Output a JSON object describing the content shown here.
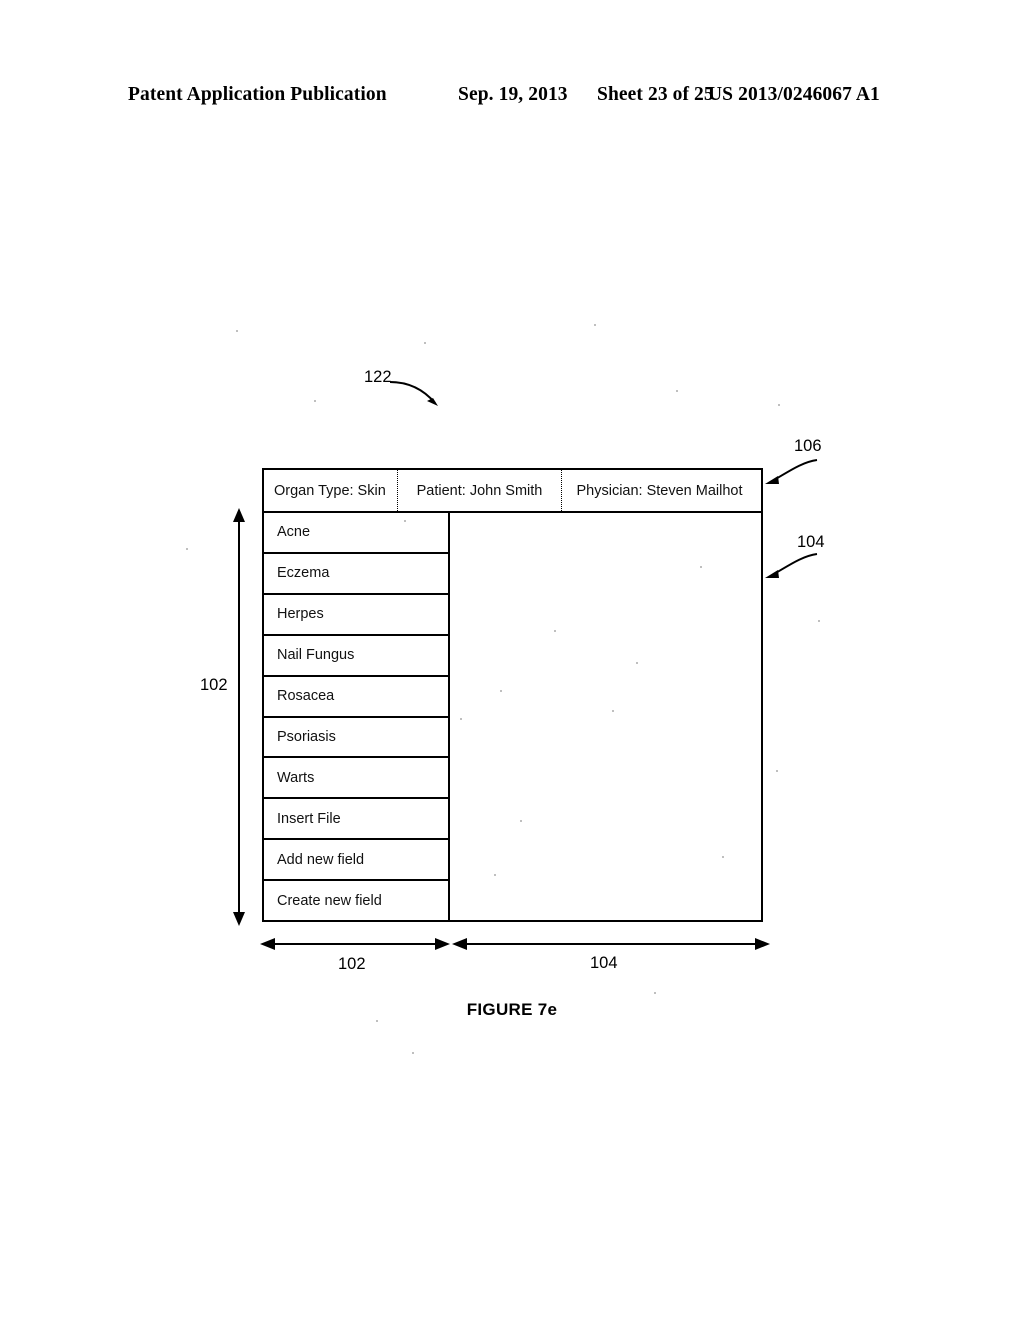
{
  "page_header": {
    "publication": "Patent Application Publication",
    "date": "Sep. 19, 2013",
    "sheet": "Sheet 23 of 25",
    "patent_number": "US 2013/0246067 A1"
  },
  "figure": {
    "caption": "FIGURE 7e",
    "reference_numerals": {
      "window": "122",
      "header_bar": "106",
      "content_pane_right": "104",
      "list_panel_left": "102",
      "list_width_bottom": "102",
      "content_width_bottom": "104"
    }
  },
  "window": {
    "header": {
      "organ_type": "Organ Type: Skin",
      "patient": "Patient: John Smith",
      "physician": "Physician: Steven Mailhot"
    },
    "list_items": [
      {
        "label": "Acne"
      },
      {
        "label": "Eczema"
      },
      {
        "label": "Herpes"
      },
      {
        "label": "Nail Fungus"
      },
      {
        "label": "Rosacea"
      },
      {
        "label": "Psoriasis"
      },
      {
        "label": "Warts"
      },
      {
        "label": "Insert File"
      },
      {
        "label": "Add new field"
      },
      {
        "label": "Create new field"
      }
    ],
    "content_pane": {
      "text": ""
    }
  },
  "colors": {
    "ink": "#000000",
    "paper": "#ffffff"
  }
}
